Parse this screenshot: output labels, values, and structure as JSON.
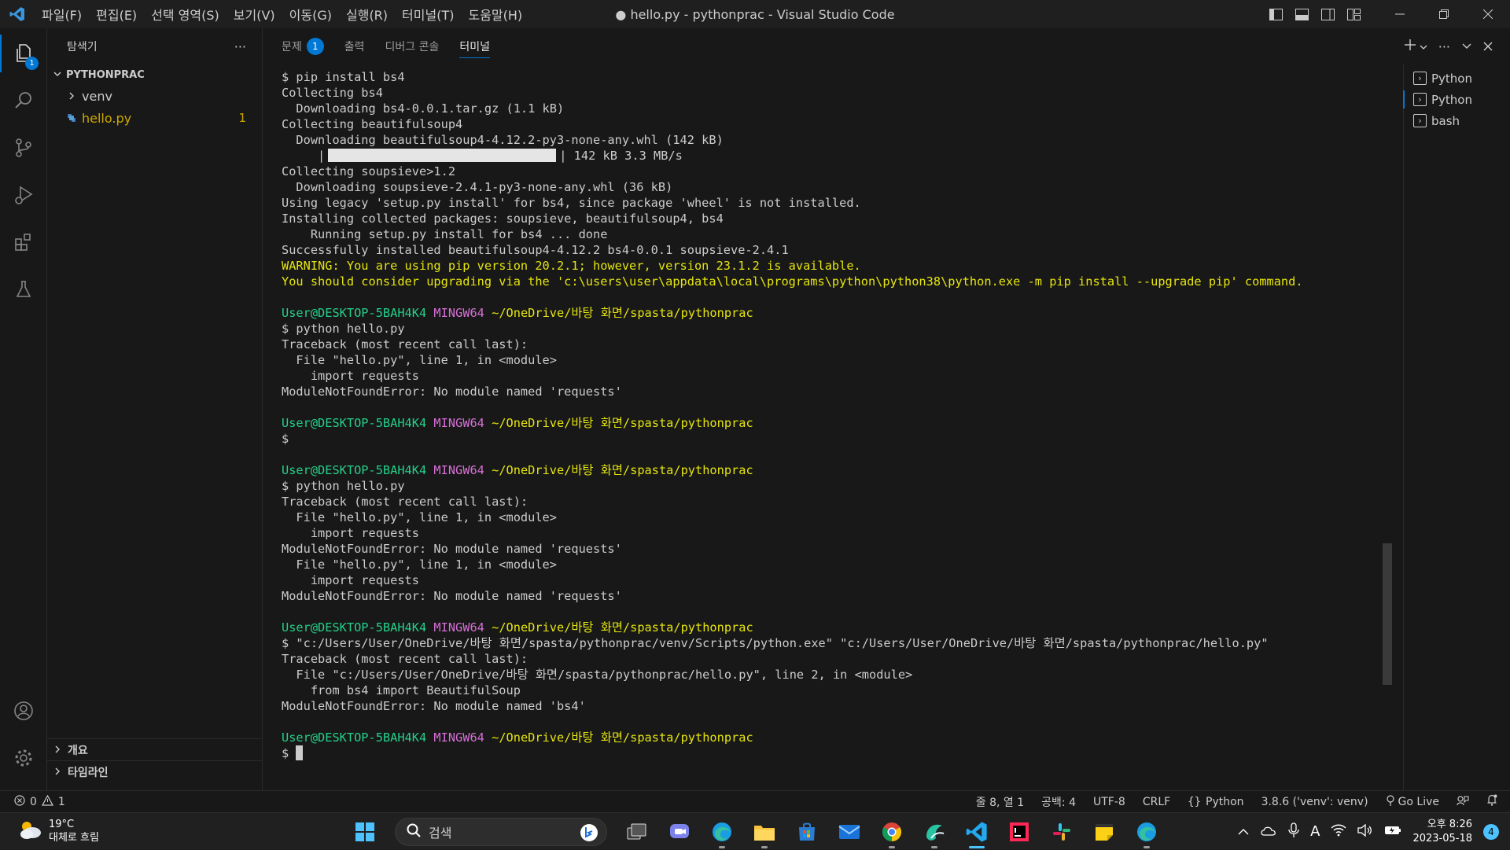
{
  "window": {
    "title": "● hello.py - pythonprac - Visual Studio Code",
    "menu": [
      "파일(F)",
      "편집(E)",
      "선택 영역(S)",
      "보기(V)",
      "이동(G)",
      "실행(R)",
      "터미널(T)",
      "도움말(H)"
    ]
  },
  "activity": {
    "explorer_badge": "1"
  },
  "sidebar": {
    "header": "탐색기",
    "more": "···",
    "folder": "PYTHONPRAC",
    "items": [
      {
        "label": "venv",
        "type": "folder"
      },
      {
        "label": "hello.py",
        "type": "file",
        "count": "1"
      }
    ],
    "outline": "개요",
    "timeline": "타임라인"
  },
  "panel": {
    "tabs": [
      {
        "label": "문제",
        "count": "1"
      },
      {
        "label": "출력"
      },
      {
        "label": "디버그 콘솔"
      },
      {
        "label": "터미널",
        "active": true
      }
    ]
  },
  "terminal": {
    "lines": [
      [
        {
          "t": "$ pip install bs4"
        }
      ],
      [
        {
          "t": "Collecting bs4"
        }
      ],
      [
        {
          "t": "  Downloading bs4-0.0.1.tar.gz (1.1 kB)"
        }
      ],
      [
        {
          "t": "Collecting beautifulsoup4"
        }
      ],
      [
        {
          "t": "  Downloading beautifulsoup4-4.12.2-py3-none-any.whl (142 kB)"
        }
      ],
      [
        {
          "t": "     |"
        },
        {
          "progress": true
        },
        {
          "t": "| 142 kB 3.3 MB/s"
        }
      ],
      [
        {
          "t": "Collecting soupsieve>1.2"
        }
      ],
      [
        {
          "t": "  Downloading soupsieve-2.4.1-py3-none-any.whl (36 kB)"
        }
      ],
      [
        {
          "t": "Using legacy 'setup.py install' for bs4, since package 'wheel' is not installed."
        }
      ],
      [
        {
          "t": "Installing collected packages: soupsieve, beautifulsoup4, bs4"
        }
      ],
      [
        {
          "t": "    Running setup.py install for bs4 ... done"
        }
      ],
      [
        {
          "t": "Successfully installed beautifulsoup4-4.12.2 bs4-0.0.1 soupsieve-2.4.1"
        }
      ],
      [
        {
          "t": "WARNING: You are using pip version 20.2.1; however, version 23.1.2 is available.",
          "c": "c-warn"
        }
      ],
      [
        {
          "t": "You should consider upgrading via the 'c:\\users\\user\\appdata\\local\\programs\\python\\python38\\python.exe -m pip install --upgrade pip' command.",
          "c": "c-warn"
        }
      ],
      [],
      [
        {
          "t": "User@DESKTOP-5BAH4K4",
          "c": "c-green"
        },
        {
          "t": " "
        },
        {
          "t": "MINGW64",
          "c": "c-mag"
        },
        {
          "t": " "
        },
        {
          "t": "~/OneDrive/바탕 화면/spasta/pythonprac",
          "c": "c-yel"
        }
      ],
      [
        {
          "t": "$ python hello.py"
        }
      ],
      [
        {
          "t": "Traceback (most recent call last):"
        }
      ],
      [
        {
          "t": "  File \"hello.py\", line 1, in <module>"
        }
      ],
      [
        {
          "t": "    import requests"
        }
      ],
      [
        {
          "t": "ModuleNotFoundError: No module named 'requests'"
        }
      ],
      [],
      [
        {
          "t": "User@DESKTOP-5BAH4K4",
          "c": "c-green"
        },
        {
          "t": " "
        },
        {
          "t": "MINGW64",
          "c": "c-mag"
        },
        {
          "t": " "
        },
        {
          "t": "~/OneDrive/바탕 화면/spasta/pythonprac",
          "c": "c-yel"
        }
      ],
      [
        {
          "t": "$"
        }
      ],
      [],
      [
        {
          "t": "User@DESKTOP-5BAH4K4",
          "c": "c-green"
        },
        {
          "t": " "
        },
        {
          "t": "MINGW64",
          "c": "c-mag"
        },
        {
          "t": " "
        },
        {
          "t": "~/OneDrive/바탕 화면/spasta/pythonprac",
          "c": "c-yel"
        }
      ],
      [
        {
          "t": "$ python hello.py"
        }
      ],
      [
        {
          "t": "Traceback (most recent call last):"
        }
      ],
      [
        {
          "t": "  File \"hello.py\", line 1, in <module>"
        }
      ],
      [
        {
          "t": "    import requests"
        }
      ],
      [
        {
          "t": "ModuleNotFoundError: No module named 'requests'"
        }
      ],
      [
        {
          "t": "  File \"hello.py\", line 1, in <module>"
        }
      ],
      [
        {
          "t": "    import requests"
        }
      ],
      [
        {
          "t": "ModuleNotFoundError: No module named 'requests'"
        }
      ],
      [],
      [
        {
          "t": "User@DESKTOP-5BAH4K4",
          "c": "c-green"
        },
        {
          "t": " "
        },
        {
          "t": "MINGW64",
          "c": "c-mag"
        },
        {
          "t": " "
        },
        {
          "t": "~/OneDrive/바탕 화면/spasta/pythonprac",
          "c": "c-yel"
        }
      ],
      [
        {
          "t": "$ \"c:/Users/User/OneDrive/바탕 화면/spasta/pythonprac/venv/Scripts/python.exe\" \"c:/Users/User/OneDrive/바탕 화면/spasta/pythonprac/hello.py\""
        }
      ],
      [
        {
          "t": "Traceback (most recent call last):"
        }
      ],
      [
        {
          "t": "  File \"c:/Users/User/OneDrive/바탕 화면/spasta/pythonprac/hello.py\", line 2, in <module>"
        }
      ],
      [
        {
          "t": "    from bs4 import BeautifulSoup"
        }
      ],
      [
        {
          "t": "ModuleNotFoundError: No module named 'bs4'"
        }
      ],
      [],
      [
        {
          "t": "User@DESKTOP-5BAH4K4",
          "c": "c-green"
        },
        {
          "t": " "
        },
        {
          "t": "MINGW64",
          "c": "c-mag"
        },
        {
          "t": " "
        },
        {
          "t": "~/OneDrive/바탕 화면/spasta/pythonprac",
          "c": "c-yel"
        }
      ],
      [
        {
          "t": "$ "
        },
        {
          "cursor": true
        }
      ]
    ],
    "progress_fraction": 1.0
  },
  "terminal_list": [
    "Python",
    "Python",
    "bash"
  ],
  "statusbar": {
    "errors": "0",
    "warnings": "1",
    "position": "줄 8, 열 1",
    "spaces": "공백: 4",
    "encoding": "UTF-8",
    "eol": "CRLF",
    "language": "Python",
    "interpreter": "3.8.6 ('venv': venv)",
    "golive": "Go Live"
  },
  "taskbar": {
    "temp": "19°C",
    "weather": "대체로 흐림",
    "search_placeholder": "검색",
    "time": "오후 8:26",
    "date": "2023-05-18",
    "notifications": "4"
  }
}
